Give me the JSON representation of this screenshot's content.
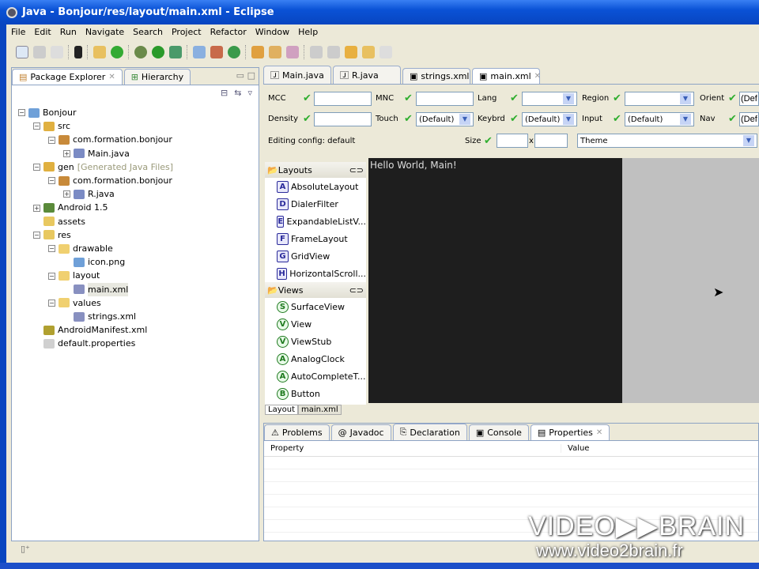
{
  "window": {
    "title": "Java - Bonjour/res/layout/main.xml - Eclipse"
  },
  "menu": [
    "File",
    "Edit",
    "Run",
    "Navigate",
    "Search",
    "Project",
    "Refactor",
    "Window",
    "Help"
  ],
  "left_tabs": [
    {
      "label": "Package Explorer"
    },
    {
      "label": "Hierarchy"
    }
  ],
  "tree": [
    {
      "label": "Bonjour",
      "depth": 0,
      "pm": "-",
      "color": "#6fa0d8"
    },
    {
      "label": "src",
      "depth": 1,
      "pm": "-",
      "color": "#e0b040"
    },
    {
      "label": "com.formation.bonjour",
      "depth": 2,
      "pm": "-",
      "color": "#c88a3a"
    },
    {
      "label": "Main.java",
      "depth": 3,
      "pm": "+",
      "color": "#7b8bc4"
    },
    {
      "label": "gen",
      "suffix": "[Generated Java Files]",
      "depth": 1,
      "pm": "-",
      "color": "#e0b040"
    },
    {
      "label": "com.formation.bonjour",
      "depth": 2,
      "pm": "-",
      "color": "#c88a3a"
    },
    {
      "label": "R.java",
      "depth": 3,
      "pm": "+",
      "color": "#7b8bc4"
    },
    {
      "label": "Android 1.5",
      "depth": 1,
      "pm": "+",
      "color": "#5a8a3a"
    },
    {
      "label": "assets",
      "depth": 1,
      "pm": "",
      "color": "#e8c860"
    },
    {
      "label": "res",
      "depth": 1,
      "pm": "-",
      "color": "#e8c860"
    },
    {
      "label": "drawable",
      "depth": 2,
      "pm": "-",
      "color": "#f0d070"
    },
    {
      "label": "icon.png",
      "depth": 3,
      "pm": "",
      "color": "#6fa0d8"
    },
    {
      "label": "layout",
      "depth": 2,
      "pm": "-",
      "color": "#f0d070"
    },
    {
      "label": "main.xml",
      "depth": 3,
      "pm": "",
      "color": "#8890c0",
      "selected": true
    },
    {
      "label": "values",
      "depth": 2,
      "pm": "-",
      "color": "#f0d070"
    },
    {
      "label": "strings.xml",
      "depth": 3,
      "pm": "",
      "color": "#8890c0"
    },
    {
      "label": "AndroidManifest.xml",
      "depth": 1,
      "pm": "",
      "color": "#b0a030"
    },
    {
      "label": "default.properties",
      "depth": 1,
      "pm": "",
      "color": "#d0d0d0"
    }
  ],
  "editor_tabs": [
    {
      "label": "Main.java"
    },
    {
      "label": "R.java"
    },
    {
      "label": "strings.xml"
    },
    {
      "label": "main.xml",
      "active": true
    }
  ],
  "config": {
    "mcc": "MCC",
    "mnc": "MNC",
    "lang": "Lang",
    "region": "Region",
    "orient": "Orient",
    "orient_value": "(Def",
    "density": "Density",
    "touch": "Touch",
    "touch_value": "(Default)",
    "keybrd": "Keybrd",
    "keybrd_value": "(Default)",
    "input": "Input",
    "input_value": "(Default)",
    "nav": "Nav",
    "nav_value": "(Def",
    "editing": "Editing config:  default",
    "size": "Size",
    "size_x": "x",
    "theme": "Theme"
  },
  "palette": {
    "layouts_label": "Layouts",
    "layouts": [
      {
        "b": "A",
        "label": "AbsoluteLayout"
      },
      {
        "b": "D",
        "label": "DialerFilter"
      },
      {
        "b": "E",
        "label": "ExpandableListV..."
      },
      {
        "b": "F",
        "label": "FrameLayout"
      },
      {
        "b": "G",
        "label": "GridView"
      },
      {
        "b": "H",
        "label": "HorizontalScroll..."
      }
    ],
    "views_label": "Views",
    "views": [
      {
        "b": "S",
        "label": "SurfaceView"
      },
      {
        "b": "V",
        "label": "View"
      },
      {
        "b": "V",
        "label": "ViewStub"
      },
      {
        "b": "A",
        "label": "AnalogClock"
      },
      {
        "b": "A",
        "label": "AutoCompleteT..."
      },
      {
        "b": "B",
        "label": "Button"
      }
    ]
  },
  "canvas_text": "Hello World, Main!",
  "editor_bottom_tabs": [
    "Layout",
    "main.xml"
  ],
  "bottom_tabs": [
    {
      "label": "Problems"
    },
    {
      "label": "Javadoc"
    },
    {
      "label": "Declaration"
    },
    {
      "label": "Console"
    },
    {
      "label": "Properties",
      "active": true
    }
  ],
  "properties": {
    "col_property": "Property",
    "col_value": "Value"
  },
  "watermark": {
    "brand": "VIDEO2BRAIN",
    "url": "www.video2brain.fr"
  }
}
